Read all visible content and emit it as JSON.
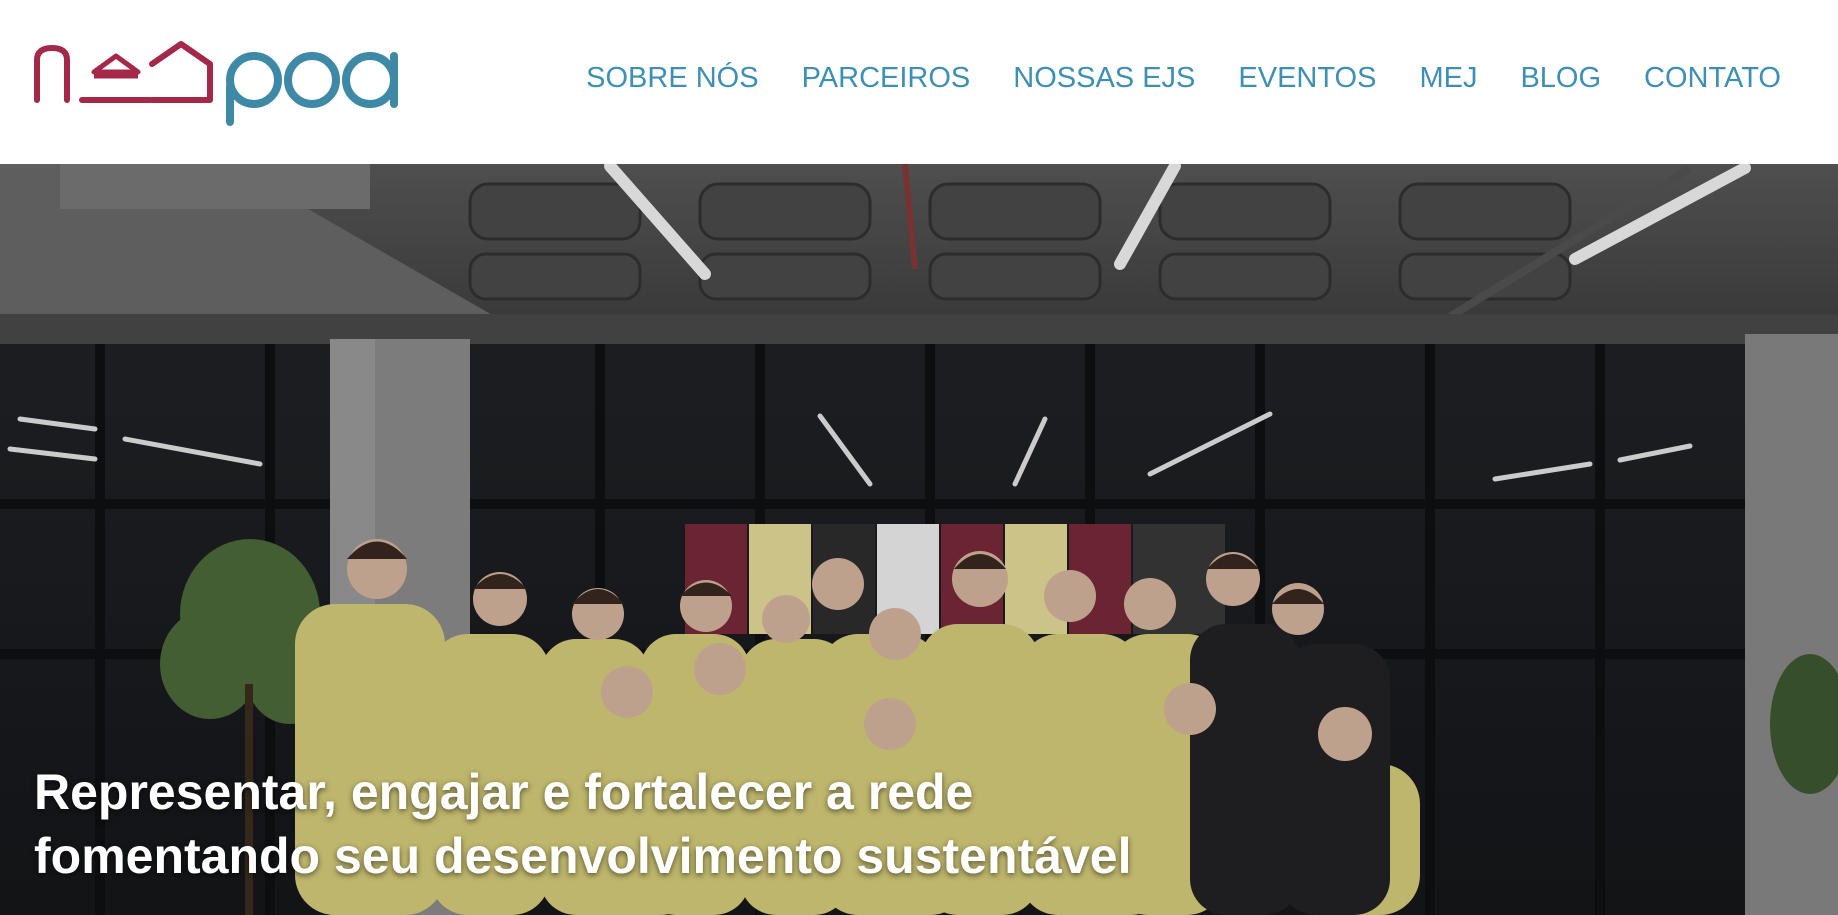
{
  "brand": {
    "logo_text": "neopoa",
    "colors": {
      "house": "#a3284a",
      "wordmark": "#3e8aa6"
    }
  },
  "nav": {
    "items": [
      {
        "label": "SOBRE NÓS"
      },
      {
        "label": "PARCEIROS"
      },
      {
        "label": "NOSSAS EJS"
      },
      {
        "label": "EVENTOS"
      },
      {
        "label": "MEJ"
      },
      {
        "label": "BLOG"
      },
      {
        "label": "CONTATO"
      }
    ],
    "color": "#3d8fb4"
  },
  "hero": {
    "image_subject": "group-photo",
    "headline_line1": "Representar, engajar e fortalecer a rede",
    "headline_line2": "fomentando seu desenvolvimento sustentável"
  }
}
